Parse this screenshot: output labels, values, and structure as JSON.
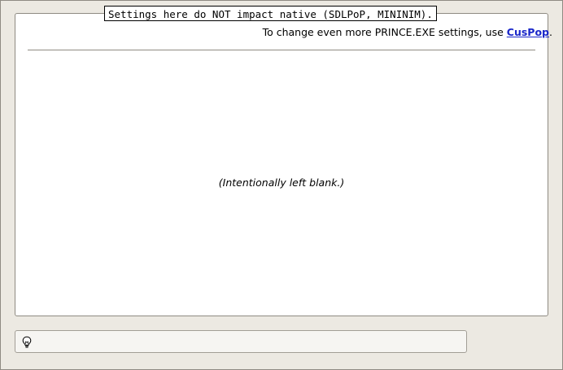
{
  "settings_group": {
    "legend": "Settings here do NOT impact native (SDLPoP, MININIM).",
    "info_prefix": "To change even more PRINCE.EXE settings, use ",
    "info_link": "CusPop",
    "info_suffix": ".",
    "blank_note": "(Intentionally left blank.)"
  },
  "statusbar": {
    "icon": "lightbulb-icon",
    "text": ""
  },
  "colors": {
    "background": "#ece9e2",
    "panel": "#ffffff",
    "link": "#1a27c9",
    "border": "#8f8b83"
  }
}
